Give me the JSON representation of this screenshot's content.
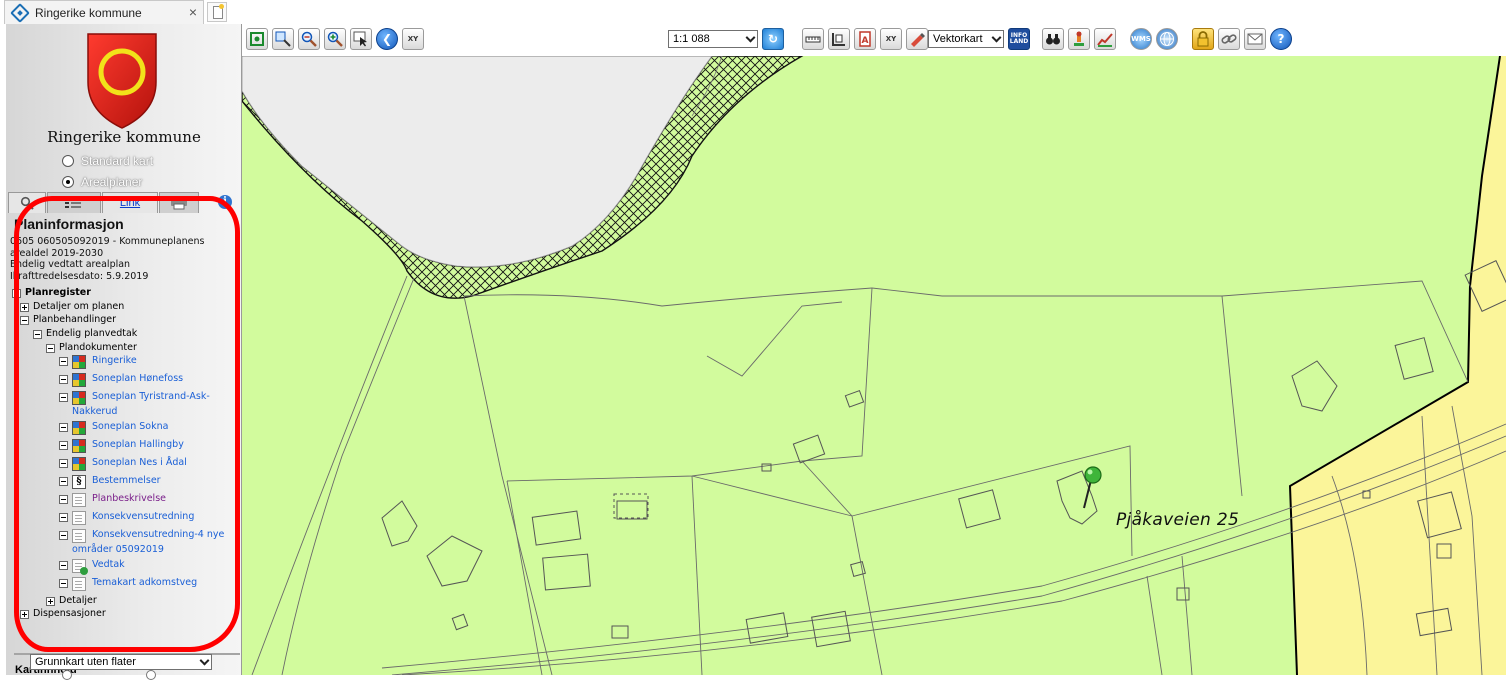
{
  "browser": {
    "tab_title": "Ringerike kommune",
    "close_glyph": "×"
  },
  "left_panel": {
    "municipality": "Ringerike kommune",
    "radio_options": [
      {
        "label": "Standard kart",
        "checked": false
      },
      {
        "label": "Arealplaner",
        "checked": true
      }
    ],
    "tab_link_label": "Link",
    "info_glyph": "i",
    "plan_title": "Planinformasjon",
    "plan_lines": [
      "0605 060505092019 - Kommuneplanens",
      "arealdel 2019-2030",
      "Endelig vedtatt arealplan",
      "Ikrafttredelsesdato: 5.9.2019"
    ],
    "tree": {
      "planregister": "Planregister",
      "detaljer_om_planen": "Detaljer om planen",
      "planbehandlinger": "Planbehandlinger",
      "endelig_planvedtak": "Endelig planvedtak",
      "plandokumenter": "Plandokumenter",
      "documents": [
        {
          "label": "Ringerike",
          "icon": "map-icon"
        },
        {
          "label": "Soneplan Hønefoss",
          "icon": "map-icon"
        },
        {
          "label": "Soneplan Tyristrand-Ask-",
          "label2": "Nakkerud",
          "icon": "map-icon"
        },
        {
          "label": "Soneplan Sokna",
          "icon": "map-icon"
        },
        {
          "label": "Soneplan Hallingby",
          "icon": "map-icon"
        },
        {
          "label": "Soneplan Nes i Ådal",
          "icon": "map-icon"
        },
        {
          "label": "Bestemmelser",
          "icon": "paragraph-icon"
        },
        {
          "label": "Planbeskrivelse",
          "icon": "document-icon"
        },
        {
          "label": "Konsekvensutredning",
          "icon": "document-icon"
        },
        {
          "label": "Konsekvensutredning-4 nye",
          "label2": "områder 05092019",
          "icon": "document-icon"
        },
        {
          "label": "Vedtak",
          "icon": "document-check-icon"
        },
        {
          "label": "Temakart adkomstveg",
          "icon": "document-icon"
        }
      ],
      "detaljer": "Detaljer",
      "dispensasjoner": "Dispensasjoner"
    },
    "kartinnhold_label": "Kartinnhold",
    "kartinnhold_value": "Grunnkart uten flater"
  },
  "toolbar": {
    "scale_value": "1:1 088",
    "map_type_value": "Vektorkart",
    "xy_label": "XY",
    "wms_label": "WMS",
    "infoland_label": "INFO LAND",
    "icons": [
      "zoom-extent-icon",
      "zoom-box-icon",
      "zoom-out-icon",
      "zoom-in-icon",
      "select-icon",
      "back-icon",
      "xy-icon",
      "refresh-icon",
      "measure-icon",
      "area-measure-icon",
      "address-icon",
      "coordinate-icon",
      "draw-icon",
      "infoland-icon",
      "binoculars-icon",
      "pin-icon",
      "profile-icon",
      "wms-icon",
      "globe-icon",
      "lock-icon",
      "link-icon",
      "mail-icon",
      "help-icon"
    ]
  },
  "map": {
    "address_label": "Pjåkaveien 25",
    "colors": {
      "lnf_green": "#d2fb9d",
      "residential_yellow": "#fbf59a",
      "water_grey": "#ececec",
      "boundary": "#000000"
    }
  },
  "annotation": {
    "highlight_color": "#ff0000"
  }
}
